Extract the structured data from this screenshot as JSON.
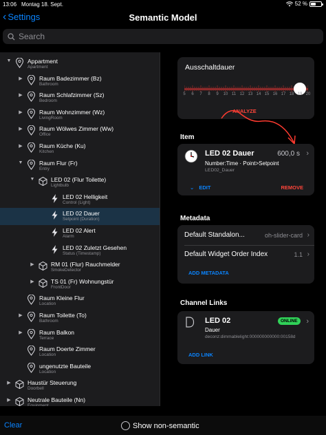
{
  "status_bar": {
    "time": "13:06",
    "date": "Montag 18. Sept.",
    "battery": "52 %",
    "battery_level": 0.52
  },
  "nav": {
    "back_label": "Settings",
    "title": "Semantic Model"
  },
  "search": {
    "placeholder": "Search"
  },
  "tree": [
    {
      "label": "Appartment",
      "sub": "Apartment",
      "level": 0,
      "arrow": "down",
      "icon": "location-pin-icon"
    },
    {
      "label": "Raum Badezimmer (Bz)",
      "sub": "Bathroom",
      "level": 1,
      "arrow": "right",
      "icon": "location-pin-icon"
    },
    {
      "label": "Raum Schlafzimmer (Sz)",
      "sub": "Bedroom",
      "level": 1,
      "arrow": "right",
      "icon": "location-pin-icon"
    },
    {
      "label": "Raum Wohnzimmer (Wz)",
      "sub": "LivingRoom",
      "level": 1,
      "arrow": "right",
      "icon": "location-pin-icon"
    },
    {
      "label": "Raum Wölwes Zimmer (Ww)",
      "sub": "Office",
      "level": 1,
      "arrow": "right",
      "icon": "location-pin-icon"
    },
    {
      "label": "Raum Küche (Ku)",
      "sub": "Kitchen",
      "level": 1,
      "arrow": "right",
      "icon": "location-pin-icon"
    },
    {
      "label": "Raum Flur (Fr)",
      "sub": "Entry",
      "level": 1,
      "arrow": "down",
      "icon": "location-pin-icon"
    },
    {
      "label": "LED 02 (Flur Toilette)",
      "sub": "Lightbulb",
      "level": 2,
      "arrow": "down",
      "icon": "cube-icon"
    },
    {
      "label": "LED 02 Helligkeit",
      "sub": "Control (Light)",
      "level": 3,
      "arrow": "",
      "icon": "bolt-icon"
    },
    {
      "label": "LED 02 Dauer",
      "sub": "Setpoint (Duration)",
      "level": 3,
      "arrow": "",
      "icon": "bolt-icon",
      "selected": true
    },
    {
      "label": "LED 02 Alert",
      "sub": "Alarm",
      "level": 3,
      "arrow": "",
      "icon": "bolt-icon"
    },
    {
      "label": "LED 02 Zuletzt Gesehen",
      "sub": "Status (Timestamp)",
      "level": 3,
      "arrow": "",
      "icon": "bolt-icon"
    },
    {
      "label": "RM 01 (Flur) Rauchmelder",
      "sub": "SmokeDetector",
      "level": 2,
      "arrow": "right",
      "icon": "cube-icon"
    },
    {
      "label": "TS 01 (Fr) Wohnungstür",
      "sub": "FrontDoor",
      "level": 2,
      "arrow": "right",
      "icon": "cube-icon"
    },
    {
      "label": "Raum Kleine Flur",
      "sub": "Location",
      "level": 1,
      "arrow": "",
      "icon": "location-pin-icon"
    },
    {
      "label": "Raum Toilette (To)",
      "sub": "Bathroom",
      "level": 1,
      "arrow": "right",
      "icon": "location-pin-icon"
    },
    {
      "label": "Raum Balkon",
      "sub": "Terrace",
      "level": 1,
      "arrow": "right",
      "icon": "location-pin-icon"
    },
    {
      "label": "Raum Doerte Zimmer",
      "sub": "Location",
      "level": 1,
      "arrow": "",
      "icon": "location-pin-icon"
    },
    {
      "label": "ungenutzte Bauteile",
      "sub": "Location",
      "level": 1,
      "arrow": "",
      "icon": "location-pin-icon"
    },
    {
      "label": "Haustür Steuerung",
      "sub": "Doorbell",
      "level": 0,
      "arrow": "right",
      "icon": "cube-icon"
    },
    {
      "label": "Neutrale Bauteile (Nn)",
      "sub": "Equipment",
      "level": 0,
      "arrow": "right",
      "icon": "cube-icon"
    }
  ],
  "slider": {
    "title": "Ausschaltdauer",
    "min": 5,
    "max": 20,
    "value": 19,
    "tick_labels": [
      "5",
      "6",
      "7",
      "8",
      "9",
      "10",
      "11",
      "12",
      "13",
      "14",
      "15",
      "16",
      "17",
      "18",
      "19",
      "20"
    ],
    "analyze_label": "ANALYZE",
    "accent": "#ff453a"
  },
  "item": {
    "section_title": "Item",
    "title": "LED 02 Dauer",
    "value": "600,0 s",
    "type": "Number:Time · Point>Setpoint",
    "name": "LED02_Dauer",
    "edit_label": "EDIT",
    "remove_label": "REMOVE"
  },
  "metadata": {
    "section_title": "Metadata",
    "rows": [
      {
        "key": "Default Standalon...",
        "value": "oh-slider-card"
      },
      {
        "key": "Default Widget Order Index",
        "value": "1.1"
      }
    ],
    "add_label": "ADD METADATA"
  },
  "channel_links": {
    "section_title": "Channel Links",
    "title": "LED 02",
    "badge": "ONLINE",
    "sub": "Dauer",
    "uid": "deconz:dimmablelight:000000000000:00158d",
    "add_label": "ADD LINK",
    "badge_color": "#30d158"
  },
  "bottom": {
    "clear_label": "Clear",
    "toggle_label": "Show non-semantic"
  }
}
